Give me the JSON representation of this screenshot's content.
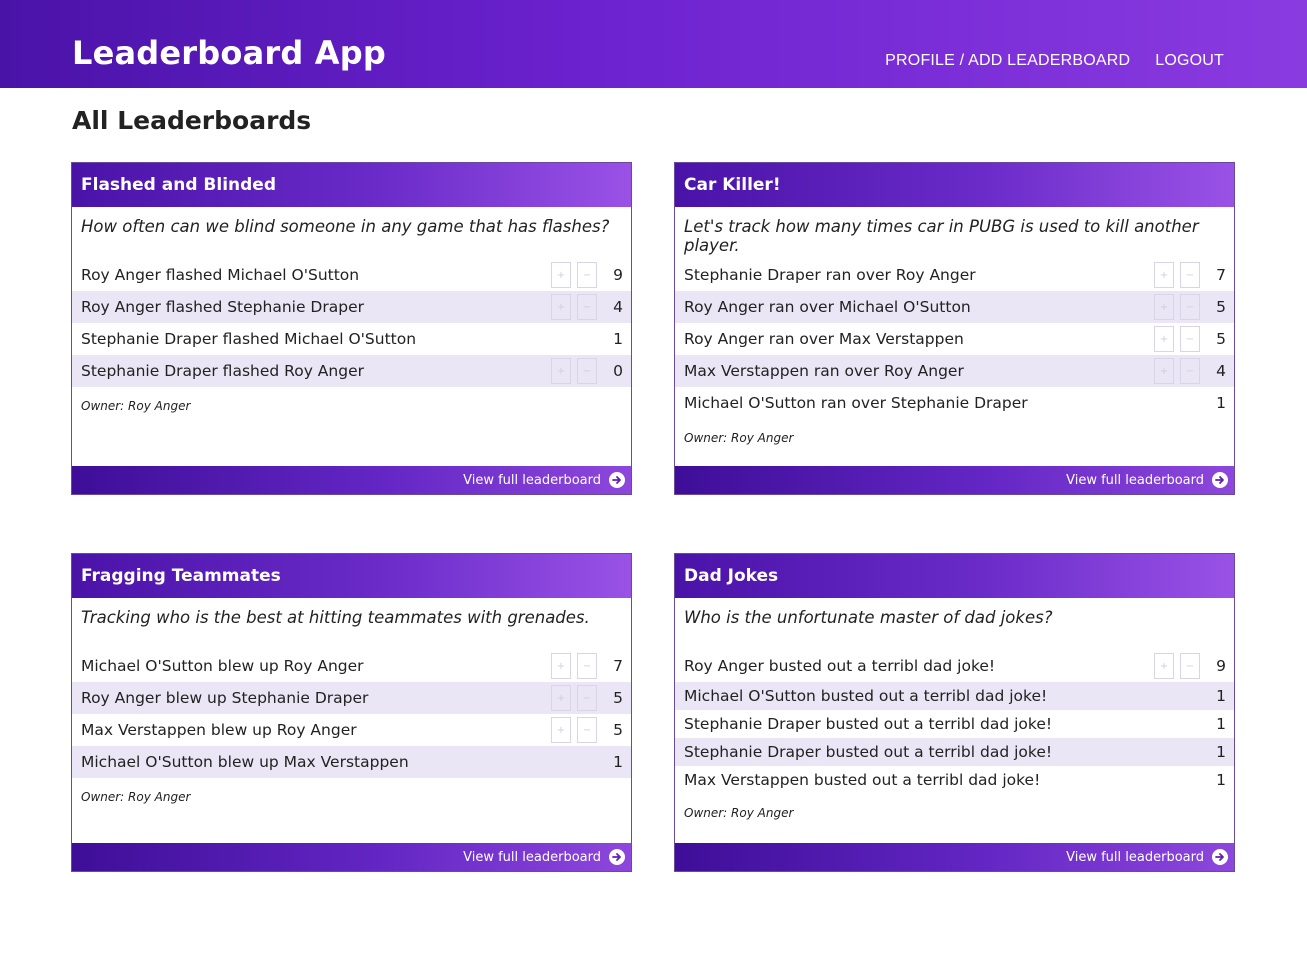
{
  "header": {
    "app_title": "Leaderboard App",
    "nav": [
      {
        "label": "PROFILE / ADD LEADERBOARD"
      },
      {
        "label": "LOGOUT"
      }
    ]
  },
  "page_title": "All Leaderboards",
  "icons": {
    "plus": "+",
    "minus": "−",
    "view_arrow": "arrow-right-circle-icon"
  },
  "boards": [
    {
      "title": "Flashed and Blinded",
      "description": "How often can we blind someone in any game that has flashes?",
      "entries": [
        {
          "text": "Roy Anger flashed Michael O'Sutton",
          "score": "9",
          "controls": true
        },
        {
          "text": "Roy Anger flashed Stephanie Draper",
          "score": "4",
          "controls": true
        },
        {
          "text": "Stephanie Draper flashed Michael O'Sutton",
          "score": "1",
          "controls": false
        },
        {
          "text": "Stephanie Draper flashed Roy Anger",
          "score": "0",
          "controls": true
        }
      ],
      "owner": "Owner: Roy Anger",
      "view_link": "View full leaderboard"
    },
    {
      "title": "Car Killer!",
      "description": "Let's track how many times car in PUBG is used to kill another player.",
      "entries": [
        {
          "text": "Stephanie Draper ran over Roy Anger",
          "score": "7",
          "controls": true
        },
        {
          "text": "Roy Anger ran over Michael O'Sutton",
          "score": "5",
          "controls": true
        },
        {
          "text": "Roy Anger ran over Max Verstappen",
          "score": "5",
          "controls": true
        },
        {
          "text": "Max Verstappen ran over Roy Anger",
          "score": "4",
          "controls": true
        },
        {
          "text": "Michael O'Sutton ran over Stephanie Draper",
          "score": "1",
          "controls": false
        }
      ],
      "owner": "Owner: Roy Anger",
      "view_link": "View full leaderboard"
    },
    {
      "title": "Fragging Teammates",
      "description": "Tracking who is the best at hitting teammates with grenades.",
      "entries": [
        {
          "text": "Michael O'Sutton blew up Roy Anger",
          "score": "7",
          "controls": true
        },
        {
          "text": "Roy Anger blew up Stephanie Draper",
          "score": "5",
          "controls": true
        },
        {
          "text": "Max Verstappen blew up Roy Anger",
          "score": "5",
          "controls": true
        },
        {
          "text": "Michael O'Sutton blew up Max Verstappen",
          "score": "1",
          "controls": false
        }
      ],
      "owner": "Owner: Roy Anger",
      "view_link": "View full leaderboard"
    },
    {
      "title": "Dad Jokes",
      "description": "Who is the unfortunate master of dad jokes?",
      "entries": [
        {
          "text": "Roy Anger busted out a terribl dad joke!",
          "score": "9",
          "controls": true
        },
        {
          "text": "Michael O'Sutton busted out a terribl dad joke!",
          "score": "1",
          "controls": false
        },
        {
          "text": "Stephanie Draper busted out a terribl dad joke!",
          "score": "1",
          "controls": false
        },
        {
          "text": "Stephanie Draper busted out a terribl dad joke!",
          "score": "1",
          "controls": false
        },
        {
          "text": "Max Verstappen busted out a terribl dad joke!",
          "score": "1",
          "controls": false
        }
      ],
      "owner": "Owner: Roy Anger",
      "view_link": "View full leaderboard"
    }
  ]
}
